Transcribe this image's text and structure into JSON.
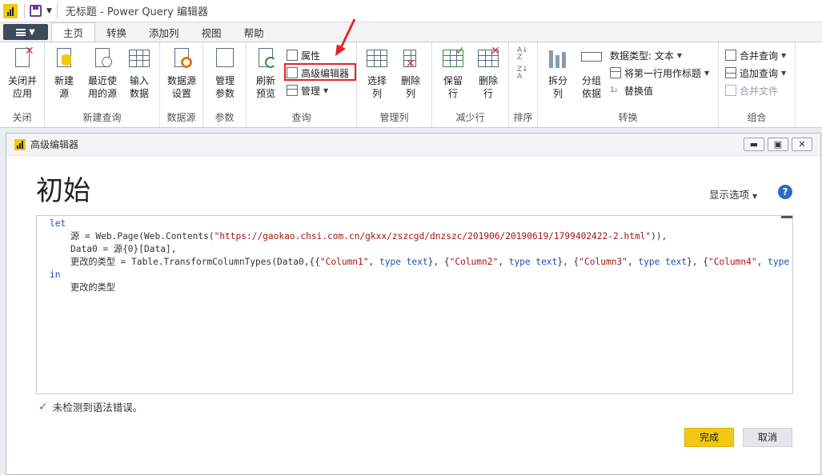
{
  "window": {
    "title": "无标题 - Power Query 编辑器"
  },
  "tabs": [
    {
      "label": "主页",
      "active": true
    },
    {
      "label": "转换"
    },
    {
      "label": "添加列"
    },
    {
      "label": "视图"
    },
    {
      "label": "帮助"
    }
  ],
  "ribbon": {
    "close": {
      "btn": "关闭并\n应用",
      "group": "关闭"
    },
    "new_query": {
      "new_source": "新建\n源",
      "recent": "最近使\n用的源",
      "enter_data": "输入\n数据",
      "group": "新建查询"
    },
    "data_source": {
      "settings": "数据源\n设置",
      "group": "数据源"
    },
    "params": {
      "manage": "管理\n参数",
      "group": "参数"
    },
    "query": {
      "refresh": "刷新\n预览",
      "properties": "属性",
      "advanced_editor": "高级编辑器",
      "manage": "管理",
      "group": "查询"
    },
    "manage_cols": {
      "choose": "选择\n列",
      "remove": "删除\n列",
      "group": "管理列"
    },
    "reduce_rows": {
      "keep": "保留\n行",
      "remove": "删除\n行",
      "group": "减少行"
    },
    "sort": {
      "group": "排序"
    },
    "transform": {
      "split": "拆分\n列",
      "group_by": "分组\n依据",
      "data_type": "数据类型: 文本",
      "first_row_header": "将第一行用作标题",
      "replace": "替换值",
      "group": "转换"
    },
    "combine": {
      "merge": "合并查询",
      "append": "追加查询",
      "combine_files": "合并文件",
      "group": "组合"
    }
  },
  "editor": {
    "title": "高级编辑器",
    "heading": "初始",
    "display_options": "显示选项",
    "help": "?",
    "code": {
      "l1": "let",
      "l2a": "源 = Web.Page(Web.Contents(",
      "l2b": "\"https://gaokao.chsi.com.cn/gkxx/zszcgd/dnzszc/201906/20190619/1799402422-2.html\"",
      "l2c": ")),",
      "l3a": "Data0 = 源{0}[Data],",
      "l4a": "更改的类型 = Table.TransformColumnTypes(Data0,{{",
      "l4b": "\"Column1\"",
      "l4c": ", ",
      "l4d": "type",
      "l4e": " text",
      "l4f": "}, {",
      "l4g": "\"Column2\"",
      "l4h": "\"Column3\"",
      "l4i": "\"Column4\"",
      "l4j": "type te",
      "l5": "in",
      "l6": "更改的类型"
    },
    "status": "未检测到语法错误。",
    "ok": "完成",
    "cancel": "取消"
  },
  "colors": {
    "accent": "#f2c811",
    "highlight": "#e52323",
    "keyword": "#1f4fb5",
    "string": "#a31515"
  }
}
